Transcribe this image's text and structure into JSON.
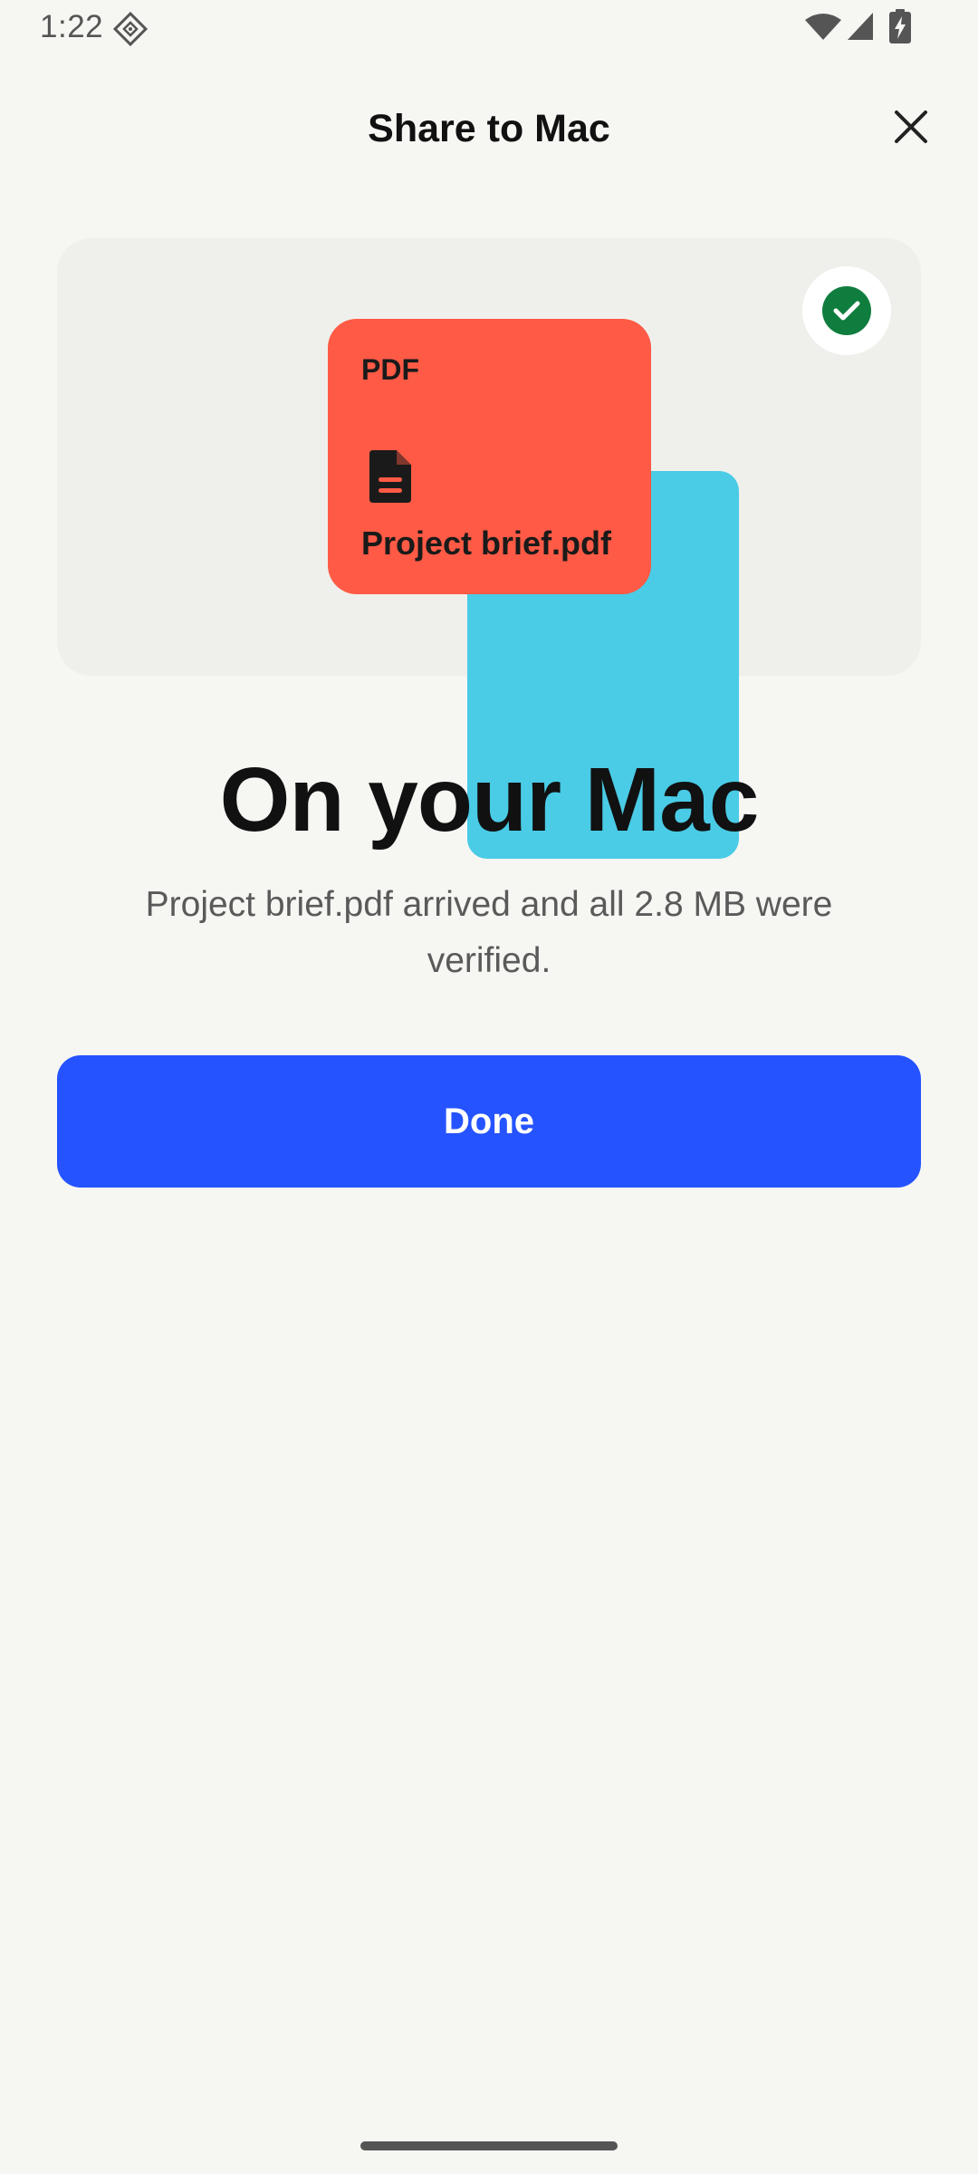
{
  "status_bar": {
    "time": "1:22",
    "icons": [
      "app-notification-icon",
      "wifi-icon",
      "cell-signal-icon",
      "battery-charging-icon"
    ]
  },
  "header": {
    "title": "Share to Mac",
    "close_icon": "close-icon"
  },
  "illustration": {
    "file_type": "PDF",
    "file_name": "Project brief.pdf",
    "doc_icon": "document-icon",
    "status_icon": "check-circle-icon"
  },
  "main": {
    "heading": "On your Mac",
    "subtitle": "Project brief.pdf arrived and all 2.8 MB were verified."
  },
  "actions": {
    "done_label": "Done"
  },
  "colors": {
    "background": "#F6F6F3",
    "card": "#EFF0EC",
    "file_front": "#FF5A45",
    "file_back": "#4ACBE6",
    "success": "#0F7D3E",
    "primary": "#2553FF"
  }
}
